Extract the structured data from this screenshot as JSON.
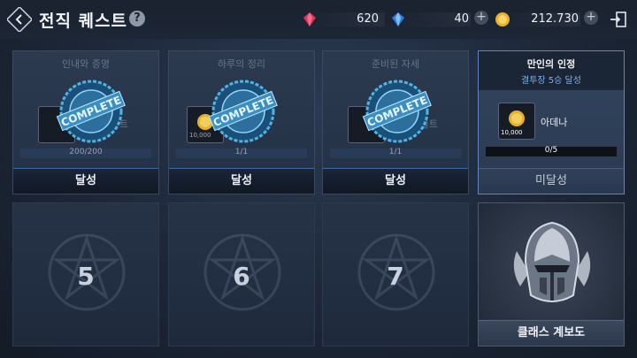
{
  "header": {
    "title": "전직 퀘스트",
    "help": "?"
  },
  "currencies": [
    {
      "icon": "red-gem-icon",
      "value": "620"
    },
    {
      "icon": "blue-gem-icon",
      "value": "40"
    },
    {
      "icon": "gold-coin-icon",
      "value": "212.730"
    }
  ],
  "quests": [
    {
      "name": "인내와 증명",
      "item": "사일 볼트",
      "progress": "200/200",
      "status": "달성",
      "completed": true
    },
    {
      "name": "하루의 정리",
      "item": "10,000",
      "progress": "1/1",
      "status": "달성",
      "completed": true
    },
    {
      "name": "준비된 자세",
      "item": "사일 볼트",
      "progress": "1/1",
      "status": "달성",
      "completed": true
    },
    {
      "name": "만인의 인정",
      "subtitle": "결투장 5승 달성",
      "item": "아데나",
      "item_count": "10,000",
      "progress": "0/5",
      "status": "미달성",
      "completed": false
    }
  ],
  "stamp_text": "COMPLETE",
  "locked": [
    "5",
    "6",
    "7"
  ],
  "class_card": {
    "label": "클래스 계보도",
    "icon": "knight-helmet-icon"
  }
}
